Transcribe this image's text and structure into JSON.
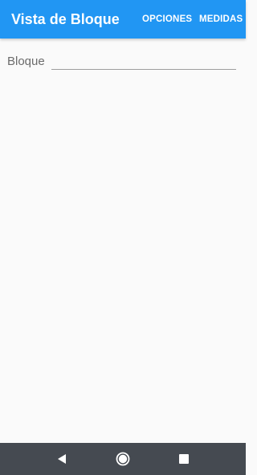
{
  "app_bar": {
    "title": "Vista de Bloque",
    "actions": {
      "opciones": "OPCIONES",
      "medidas": "MEDIDAS"
    },
    "color": "#2196f3"
  },
  "form": {
    "bloque_label": "Bloque",
    "bloque_value": ""
  },
  "navigation_bar": {
    "back_icon": "back-triangle-icon",
    "home_icon": "home-circle-icon",
    "recents_icon": "recents-square-icon",
    "color": "#454a51"
  }
}
